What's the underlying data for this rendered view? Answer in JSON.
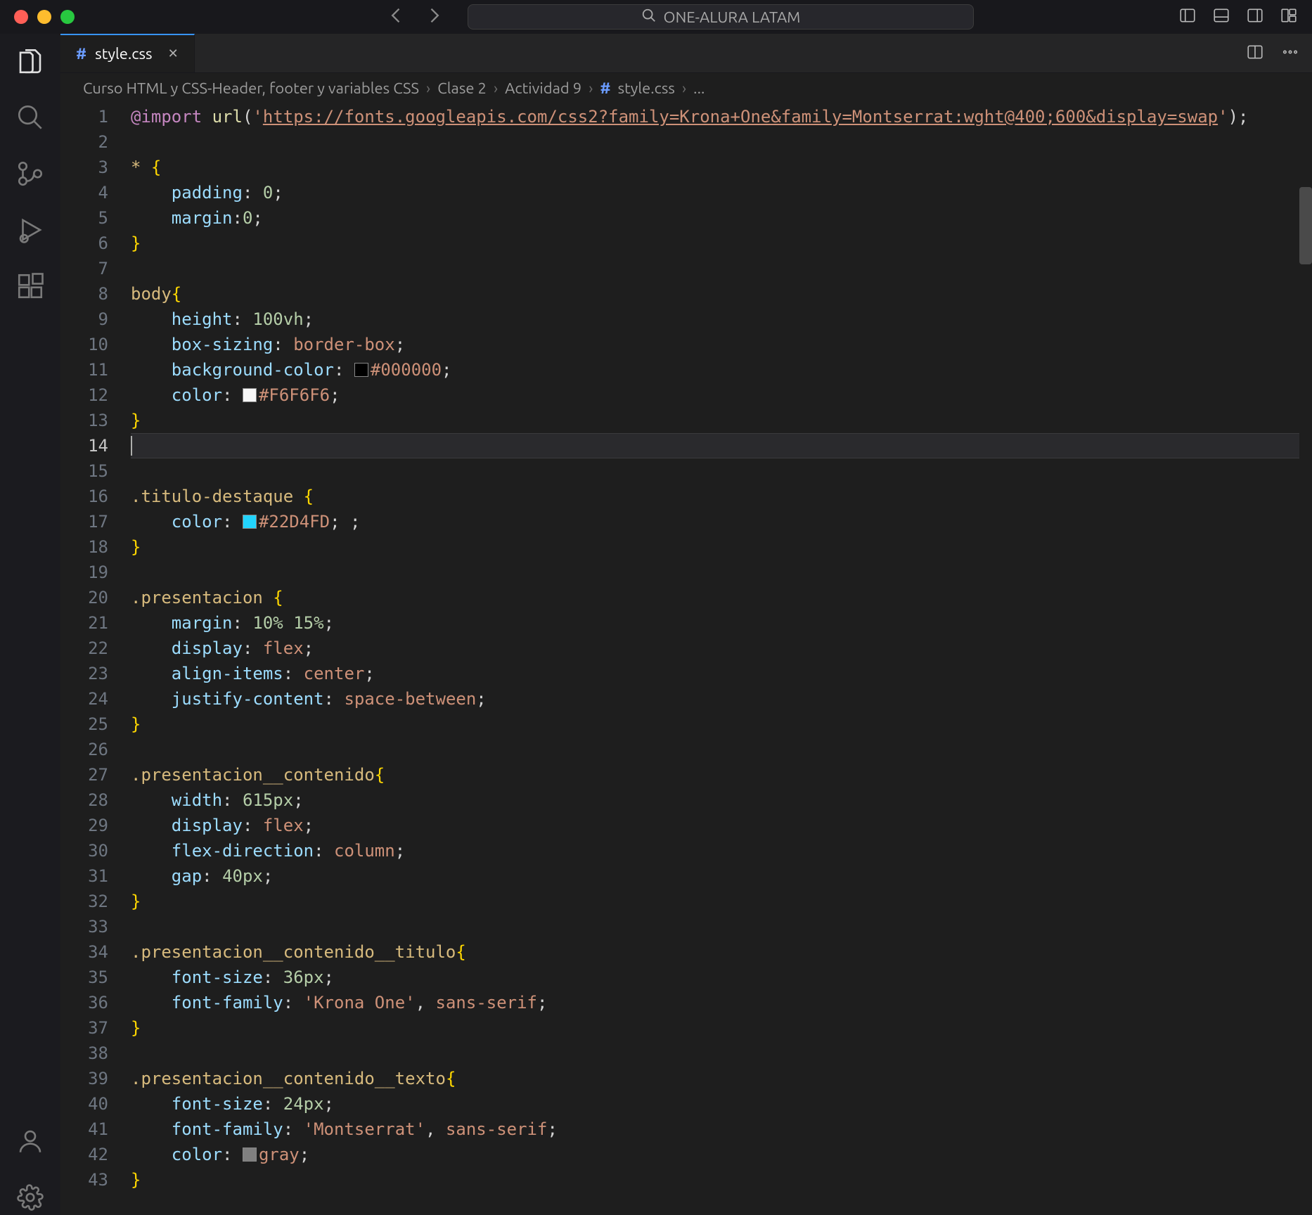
{
  "titlebar": {
    "search_text": "ONE-ALURA LATAM"
  },
  "tab": {
    "icon": "#",
    "label": "style.css"
  },
  "breadcrumbs": {
    "items": [
      "Curso HTML y CSS-Header, footer y variables CSS",
      "Clase 2",
      "Actividad 9",
      "style.css",
      "..."
    ]
  },
  "editor": {
    "current_line": 14,
    "line_numbers": [
      "1",
      "2",
      "3",
      "4",
      "5",
      "6",
      "7",
      "8",
      "9",
      "10",
      "11",
      "12",
      "13",
      "14",
      "15",
      "16",
      "17",
      "18",
      "19",
      "20",
      "21",
      "22",
      "23",
      "24",
      "25",
      "26",
      "27",
      "28",
      "29",
      "30",
      "31",
      "32",
      "33",
      "34",
      "35",
      "36",
      "37",
      "38",
      "39",
      "40",
      "41",
      "42",
      "43"
    ],
    "lines": [
      [
        {
          "t": "@import",
          "c": "atrule"
        },
        {
          "t": " ",
          "c": "plain"
        },
        {
          "t": "url",
          "c": "func"
        },
        {
          "t": "(",
          "c": "plain"
        },
        {
          "t": "'",
          "c": "string"
        },
        {
          "t": "https://fonts.googleapis.com/css2?family=Krona+One&family=Montserrat:wght@400;600&display=swap",
          "c": "url"
        },
        {
          "t": "'",
          "c": "string"
        },
        {
          "t": ");",
          "c": "plain"
        }
      ],
      [],
      [
        {
          "t": "*",
          "c": "selector"
        },
        {
          "t": " ",
          "c": "plain"
        },
        {
          "t": "{",
          "c": "punct"
        }
      ],
      [
        {
          "t": "    ",
          "c": "plain"
        },
        {
          "t": "padding",
          "c": "prop"
        },
        {
          "t": ": ",
          "c": "plain"
        },
        {
          "t": "0",
          "c": "num"
        },
        {
          "t": ";",
          "c": "plain"
        }
      ],
      [
        {
          "t": "    ",
          "c": "plain"
        },
        {
          "t": "margin",
          "c": "prop"
        },
        {
          "t": ":",
          "c": "plain"
        },
        {
          "t": "0",
          "c": "num"
        },
        {
          "t": ";",
          "c": "plain"
        }
      ],
      [
        {
          "t": "}",
          "c": "punct"
        }
      ],
      [],
      [
        {
          "t": "body",
          "c": "selector"
        },
        {
          "t": "{",
          "c": "punct"
        }
      ],
      [
        {
          "t": "    ",
          "c": "plain"
        },
        {
          "t": "height",
          "c": "prop"
        },
        {
          "t": ": ",
          "c": "plain"
        },
        {
          "t": "100vh",
          "c": "num"
        },
        {
          "t": ";",
          "c": "plain"
        }
      ],
      [
        {
          "t": "    ",
          "c": "plain"
        },
        {
          "t": "box-sizing",
          "c": "prop"
        },
        {
          "t": ": ",
          "c": "plain"
        },
        {
          "t": "border-box",
          "c": "val"
        },
        {
          "t": ";",
          "c": "plain"
        }
      ],
      [
        {
          "t": "    ",
          "c": "plain"
        },
        {
          "t": "background-color",
          "c": "prop"
        },
        {
          "t": ": ",
          "c": "plain"
        },
        {
          "swatch": "#000000"
        },
        {
          "t": "#000000",
          "c": "val"
        },
        {
          "t": ";",
          "c": "plain"
        }
      ],
      [
        {
          "t": "    ",
          "c": "plain"
        },
        {
          "t": "color",
          "c": "prop"
        },
        {
          "t": ": ",
          "c": "plain"
        },
        {
          "swatch": "#F6F6F6"
        },
        {
          "t": "#F6F6F6",
          "c": "val"
        },
        {
          "t": ";",
          "c": "plain"
        }
      ],
      [
        {
          "t": "}",
          "c": "punct"
        }
      ],
      [
        {
          "cursor": true
        }
      ],
      [],
      [
        {
          "t": ".titulo-destaque",
          "c": "selector"
        },
        {
          "t": " ",
          "c": "plain"
        },
        {
          "t": "{",
          "c": "punct"
        }
      ],
      [
        {
          "t": "    ",
          "c": "plain"
        },
        {
          "t": "color",
          "c": "prop"
        },
        {
          "t": ": ",
          "c": "plain"
        },
        {
          "swatch": "#22D4FD"
        },
        {
          "t": "#22D4FD",
          "c": "val"
        },
        {
          "t": "; ;",
          "c": "plain"
        }
      ],
      [
        {
          "t": "}",
          "c": "punct"
        }
      ],
      [],
      [
        {
          "t": ".presentacion",
          "c": "selector"
        },
        {
          "t": " ",
          "c": "plain"
        },
        {
          "t": "{",
          "c": "punct"
        }
      ],
      [
        {
          "t": "    ",
          "c": "plain"
        },
        {
          "t": "margin",
          "c": "prop"
        },
        {
          "t": ": ",
          "c": "plain"
        },
        {
          "t": "10% 15%",
          "c": "num"
        },
        {
          "t": ";",
          "c": "plain"
        }
      ],
      [
        {
          "t": "    ",
          "c": "plain"
        },
        {
          "t": "display",
          "c": "prop"
        },
        {
          "t": ": ",
          "c": "plain"
        },
        {
          "t": "flex",
          "c": "val"
        },
        {
          "t": ";",
          "c": "plain"
        }
      ],
      [
        {
          "t": "    ",
          "c": "plain"
        },
        {
          "t": "align-items",
          "c": "prop"
        },
        {
          "t": ": ",
          "c": "plain"
        },
        {
          "t": "center",
          "c": "val"
        },
        {
          "t": ";",
          "c": "plain"
        }
      ],
      [
        {
          "t": "    ",
          "c": "plain"
        },
        {
          "t": "justify-content",
          "c": "prop"
        },
        {
          "t": ": ",
          "c": "plain"
        },
        {
          "t": "space-between",
          "c": "val"
        },
        {
          "t": ";",
          "c": "plain"
        }
      ],
      [
        {
          "t": "}",
          "c": "punct"
        }
      ],
      [],
      [
        {
          "t": ".presentacion__contenido",
          "c": "selector"
        },
        {
          "t": "{",
          "c": "punct"
        }
      ],
      [
        {
          "t": "    ",
          "c": "plain"
        },
        {
          "t": "width",
          "c": "prop"
        },
        {
          "t": ": ",
          "c": "plain"
        },
        {
          "t": "615px",
          "c": "num"
        },
        {
          "t": ";",
          "c": "plain"
        }
      ],
      [
        {
          "t": "    ",
          "c": "plain"
        },
        {
          "t": "display",
          "c": "prop"
        },
        {
          "t": ": ",
          "c": "plain"
        },
        {
          "t": "flex",
          "c": "val"
        },
        {
          "t": ";",
          "c": "plain"
        }
      ],
      [
        {
          "t": "    ",
          "c": "plain"
        },
        {
          "t": "flex-direction",
          "c": "prop"
        },
        {
          "t": ": ",
          "c": "plain"
        },
        {
          "t": "column",
          "c": "val"
        },
        {
          "t": ";",
          "c": "plain"
        }
      ],
      [
        {
          "t": "    ",
          "c": "plain"
        },
        {
          "t": "gap",
          "c": "prop"
        },
        {
          "t": ": ",
          "c": "plain"
        },
        {
          "t": "40px",
          "c": "num"
        },
        {
          "t": ";",
          "c": "plain"
        }
      ],
      [
        {
          "t": "}",
          "c": "punct"
        }
      ],
      [],
      [
        {
          "t": ".presentacion__contenido__titulo",
          "c": "selector"
        },
        {
          "t": "{",
          "c": "punct"
        }
      ],
      [
        {
          "t": "    ",
          "c": "plain"
        },
        {
          "t": "font-size",
          "c": "prop"
        },
        {
          "t": ": ",
          "c": "plain"
        },
        {
          "t": "36px",
          "c": "num"
        },
        {
          "t": ";",
          "c": "plain"
        }
      ],
      [
        {
          "t": "    ",
          "c": "plain"
        },
        {
          "t": "font-family",
          "c": "prop"
        },
        {
          "t": ": ",
          "c": "plain"
        },
        {
          "t": "'Krona One'",
          "c": "string"
        },
        {
          "t": ", ",
          "c": "plain"
        },
        {
          "t": "sans-serif",
          "c": "val"
        },
        {
          "t": ";",
          "c": "plain"
        }
      ],
      [
        {
          "t": "}",
          "c": "punct"
        }
      ],
      [],
      [
        {
          "t": ".presentacion__contenido__texto",
          "c": "selector"
        },
        {
          "t": "{",
          "c": "punct"
        }
      ],
      [
        {
          "t": "    ",
          "c": "plain"
        },
        {
          "t": "font-size",
          "c": "prop"
        },
        {
          "t": ": ",
          "c": "plain"
        },
        {
          "t": "24px",
          "c": "num"
        },
        {
          "t": ";",
          "c": "plain"
        }
      ],
      [
        {
          "t": "    ",
          "c": "plain"
        },
        {
          "t": "font-family",
          "c": "prop"
        },
        {
          "t": ": ",
          "c": "plain"
        },
        {
          "t": "'Montserrat'",
          "c": "string"
        },
        {
          "t": ", ",
          "c": "plain"
        },
        {
          "t": "sans-serif",
          "c": "val"
        },
        {
          "t": ";",
          "c": "plain"
        }
      ],
      [
        {
          "t": "    ",
          "c": "plain"
        },
        {
          "t": "color",
          "c": "prop"
        },
        {
          "t": ": ",
          "c": "plain"
        },
        {
          "swatch": "#808080"
        },
        {
          "t": "gray",
          "c": "val"
        },
        {
          "t": ";",
          "c": "plain"
        }
      ],
      [
        {
          "t": "}",
          "c": "punct"
        }
      ]
    ]
  }
}
